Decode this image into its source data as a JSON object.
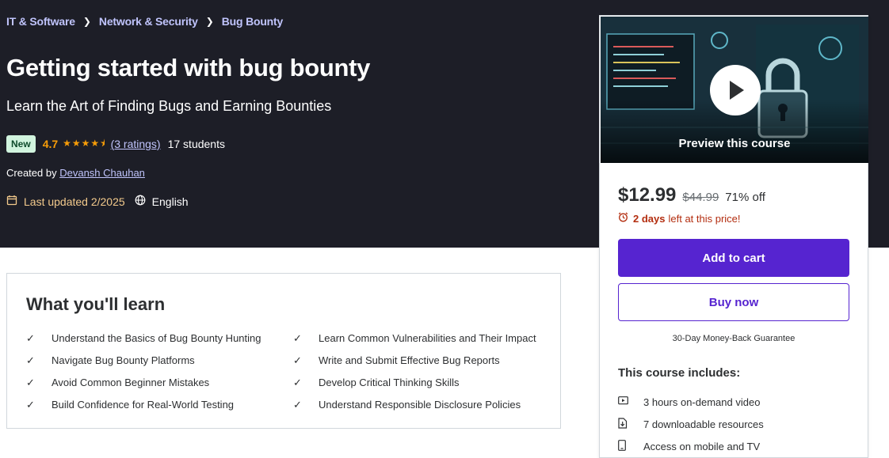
{
  "breadcrumb": [
    "IT & Software",
    "Network & Security",
    "Bug Bounty"
  ],
  "course": {
    "title": "Getting started with bug bounty",
    "subtitle": "Learn the Art of Finding Bugs and Earning Bounties",
    "badge": "New",
    "rating": "4.7",
    "ratings_text": "(3 ratings)",
    "students": "17 students",
    "created_prefix": "Created by",
    "author": "Devansh Chauhan",
    "last_updated": "Last updated 2/2025",
    "language": "English"
  },
  "learn": {
    "title": "What you'll learn",
    "items": [
      "Understand the Basics of Bug Bounty Hunting",
      "Learn Common Vulnerabilities and Their Impact",
      "Navigate Bug Bounty Platforms",
      "Write and Submit Effective Bug Reports",
      "Avoid Common Beginner Mistakes",
      "Develop Critical Thinking Skills",
      "Build Confidence for Real-World Testing",
      "Understand Responsible Disclosure Policies"
    ]
  },
  "card": {
    "preview_label": "Preview this course",
    "price": "$12.99",
    "original_price": "$44.99",
    "discount": "71% off",
    "timer_bold": "2 days",
    "timer_rest": "left at this price!",
    "add_to_cart": "Add to cart",
    "buy_now": "Buy now",
    "guarantee": "30-Day Money-Back Guarantee",
    "includes_title": "This course includes:",
    "includes": [
      {
        "icon": "video-icon",
        "label": "3 hours on-demand video"
      },
      {
        "icon": "download-file-icon",
        "label": "7 downloadable resources"
      },
      {
        "icon": "mobile-icon",
        "label": "Access on mobile and TV"
      }
    ]
  },
  "colors": {
    "hero_bg": "#1d1e27",
    "accent": "#5624d0",
    "rating": "#f69c08",
    "link": "#c0c4fc",
    "timer": "#b32d0f"
  }
}
